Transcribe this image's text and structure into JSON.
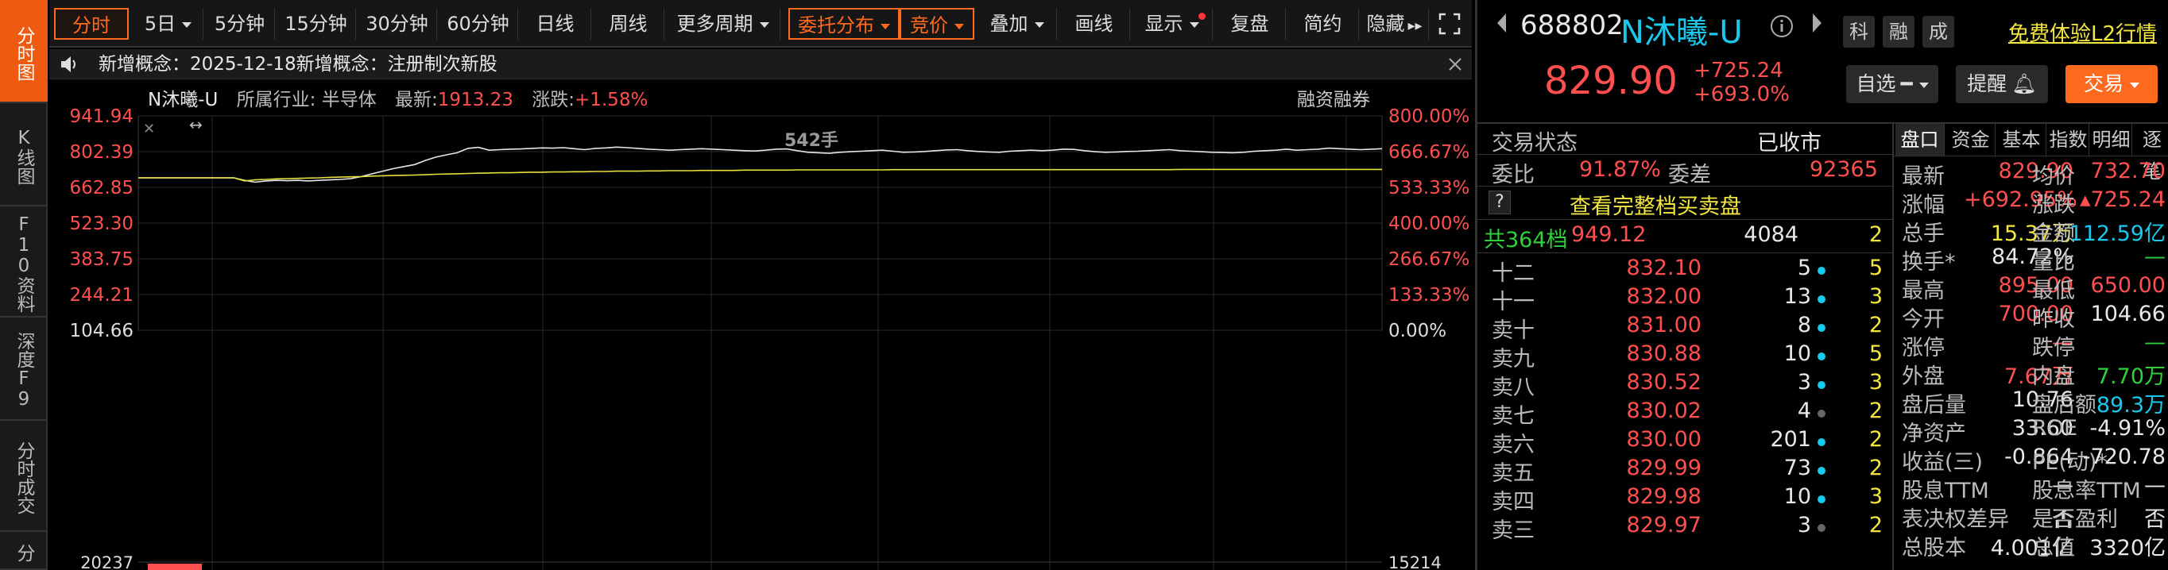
{
  "left_tabs": [
    {
      "label": "分时图"
    },
    {
      "label": "K线图"
    },
    {
      "label": "F10资料"
    },
    {
      "label": "深度F9"
    },
    {
      "label": "分时成交"
    },
    {
      "label": "分"
    }
  ],
  "toolbar": {
    "fenshi": "分时",
    "5ri": "5日",
    "5min": "5分钟",
    "15min": "15分钟",
    "30min": "30分钟",
    "60min": "60分钟",
    "rixian": "日线",
    "zhouxian": "周线",
    "more": "更多周期",
    "weituo": "委托分布",
    "jingjia": "竞价",
    "diejia": "叠加",
    "huaxian": "画线",
    "xianshi": "显示",
    "fupan": "复盘",
    "jianyue": "简约",
    "yincang": "隐藏"
  },
  "notice": {
    "text": "新增概念：2025-12-18新增概念：注册制次新股"
  },
  "chart_header": {
    "stock": "N沐曦-U",
    "industry_label": "所属行业:",
    "industry": "半导体",
    "latest_label": "最新:",
    "latest": "1913.23",
    "change_label": "涨跌:",
    "change": "+1.58%",
    "margin": "融资融券"
  },
  "chart_data": {
    "type": "line",
    "y_left_ticks": [
      "941.94",
      "802.39",
      "662.85",
      "523.30",
      "383.75",
      "244.21",
      "104.66"
    ],
    "y_right_ticks": [
      "800.00%",
      "666.67%",
      "533.33%",
      "400.00%",
      "266.67%",
      "133.33%",
      "0.00%"
    ],
    "ylim": [
      104.66,
      941.94
    ],
    "base_price": 104.66,
    "volume_left_label": "20237",
    "volume_right_label": "15214",
    "annotation": "542手",
    "series": [
      {
        "color": "#e8e8e8",
        "values": [
          700,
          700,
          700,
          700,
          700,
          700,
          700,
          700,
          700,
          700,
          690,
          683,
          688,
          690,
          689,
          690,
          688,
          690,
          692,
          694,
          697,
          705,
          716,
          726,
          736,
          744,
          752,
          768,
          781,
          790,
          798,
          815,
          819,
          808,
          810,
          812,
          813,
          815,
          817,
          816,
          818,
          814,
          810,
          815,
          817,
          820,
          818,
          815,
          812,
          810,
          808,
          810,
          812,
          814,
          812,
          810,
          808,
          806,
          805,
          808,
          812,
          813,
          806,
          800,
          798,
          796,
          800,
          802,
          804,
          806,
          808,
          804,
          800,
          801,
          803,
          806,
          809,
          810,
          806,
          803,
          801,
          800,
          804,
          806,
          808,
          806,
          808,
          812,
          811,
          806,
          802,
          800,
          801,
          803,
          804,
          806,
          808,
          810,
          806,
          804,
          802,
          800,
          799,
          798,
          800,
          804,
          806,
          808,
          812,
          808,
          810,
          812,
          816,
          814,
          812,
          810,
          812,
          814
        ]
      },
      {
        "color": "#e6e040",
        "values": [
          700,
          700,
          700,
          700,
          700,
          700,
          700,
          700,
          700,
          700,
          688,
          692,
          694,
          696,
          697,
          698,
          699,
          700,
          702,
          703,
          704,
          705,
          707,
          708,
          709,
          710,
          711,
          712,
          714,
          715,
          716,
          717,
          718,
          719,
          720,
          720,
          721,
          722,
          722,
          723,
          723,
          724,
          724,
          725,
          725,
          726,
          726,
          726,
          727,
          727,
          728,
          728,
          728,
          729,
          729,
          729,
          729,
          730,
          730,
          730,
          730,
          730,
          731,
          731,
          731,
          731,
          731,
          731,
          731,
          731,
          731,
          732,
          732,
          732,
          732,
          732,
          732,
          732,
          732,
          732,
          732,
          732,
          732,
          732,
          732,
          732,
          732,
          732,
          732,
          732,
          732,
          732,
          732,
          732,
          732,
          732,
          732,
          732,
          733,
          733,
          733,
          733,
          733,
          733,
          733,
          733,
          733,
          733,
          733,
          733,
          733,
          733,
          733,
          733,
          733,
          733,
          733,
          733
        ]
      }
    ]
  },
  "quote": {
    "code": "688802",
    "name": "N沐曦-U",
    "tags": [
      "科",
      "融",
      "成"
    ],
    "l2_link": "免费体验L2行情",
    "price": "829.90",
    "change": "+725.24",
    "change_pct": "+693.0%",
    "btn_zixuan": "自选",
    "btn_tixing": "提醒",
    "btn_jiaoyi": "交易"
  },
  "status": {
    "label": "交易状态",
    "value": "已收市"
  },
  "weibi": {
    "label1": "委比",
    "value1": "91.87%",
    "label2": "委差",
    "value2": "92365"
  },
  "full_book": {
    "q": "?",
    "text": "查看完整档买卖盘"
  },
  "total_levels": {
    "label": "共364档",
    "price": "949.12",
    "vol": "4084",
    "cnt": "2"
  },
  "levels": [
    {
      "label": "十二",
      "price": "832.10",
      "vol": "5",
      "cnt": "5",
      "dot": "#19c8ea"
    },
    {
      "label": "十一",
      "price": "832.00",
      "vol": "13",
      "cnt": "3",
      "dot": "#19c8ea"
    },
    {
      "label": "卖十",
      "price": "831.00",
      "vol": "8",
      "cnt": "2",
      "dot": "#19c8ea"
    },
    {
      "label": "卖九",
      "price": "830.88",
      "vol": "10",
      "cnt": "5",
      "dot": "#19c8ea"
    },
    {
      "label": "卖八",
      "price": "830.52",
      "vol": "3",
      "cnt": "3",
      "dot": "#19c8ea"
    },
    {
      "label": "卖七",
      "price": "830.02",
      "vol": "4",
      "cnt": "2",
      "dot": "#666666"
    },
    {
      "label": "卖六",
      "price": "830.00",
      "vol": "201",
      "cnt": "2",
      "dot": "#19c8ea"
    },
    {
      "label": "卖五",
      "price": "829.99",
      "vol": "73",
      "cnt": "2",
      "dot": "#19c8ea"
    },
    {
      "label": "卖四",
      "price": "829.98",
      "vol": "10",
      "cnt": "3",
      "dot": "#19c8ea"
    },
    {
      "label": "卖三",
      "price": "829.97",
      "vol": "3",
      "cnt": "2",
      "dot": "#666666"
    }
  ],
  "panel_tabs": [
    "盘口",
    "资金",
    "基本",
    "指数",
    "明细",
    "逐笔"
  ],
  "stats": [
    {
      "l1": "最新",
      "v1": "829.90",
      "c1": "#ff4f4f",
      "l2": "均价",
      "v2": "732.70",
      "c2": "#ff4f4f"
    },
    {
      "l1": "涨幅",
      "v1": "+692.95%",
      "c1": "#ff4f4f",
      "l2": "涨跌",
      "v2": "▴725.24",
      "c2": "#ff4f4f"
    },
    {
      "l1": "总手",
      "v1": "15.37万",
      "c1": "#f2e640",
      "l2": "金额",
      "v2": "112.59亿",
      "c2": "#19c8ea"
    },
    {
      "l1": "换手*",
      "v1": "84.72%",
      "c1": "#e8e8e8",
      "l2": "量比",
      "v2": "—",
      "c2": "#2ed13c"
    },
    {
      "l1": "最高",
      "v1": "895.00",
      "c1": "#ff4f4f",
      "l2": "最低",
      "v2": "650.00",
      "c2": "#ff4f4f"
    },
    {
      "l1": "今开",
      "v1": "700.00",
      "c1": "#ff4f4f",
      "l2": "昨收",
      "v2": "104.66",
      "c2": "#e8e8e8"
    },
    {
      "l1": "涨停",
      "v1": "—",
      "c1": "#ff4f4f",
      "l2": "跌停",
      "v2": "—",
      "c2": "#2ed13c"
    },
    {
      "l1": "外盘",
      "v1": "7.67万",
      "c1": "#ff4f4f",
      "l2": "内盘",
      "v2": "7.70万",
      "c2": "#2ed13c"
    },
    {
      "l1": "盘后量",
      "v1": "10.76",
      "c1": "#e8e8e8",
      "l2": "盘后额",
      "v2": "89.3万",
      "c2": "#19c8ea"
    },
    {
      "l1": "净资产",
      "v1": "33.60",
      "c1": "#e8e8e8",
      "l2": "ROE",
      "v2": "-4.91%",
      "c2": "#e8e8e8"
    },
    {
      "l1": "收益(三)",
      "v1": "-0.864",
      "c1": "#e8e8e8",
      "l2": "PE(动)*",
      "v2": "-720.78",
      "c2": "#e8e8e8"
    },
    {
      "l1": "股息TTM",
      "v1": "—",
      "c1": "#e8e8e8",
      "l2": "股息率TTM",
      "v2": "—",
      "c2": "#e8e8e8"
    },
    {
      "l1": "表决权差异",
      "v1": "否",
      "c1": "#e8e8e8",
      "l2": "是否盈利",
      "v2": "否",
      "c2": "#e8e8e8"
    },
    {
      "l1": "总股本",
      "v1": "4.001亿",
      "c1": "#e8e8e8",
      "l2": "总值",
      "v2": "3320亿",
      "c2": "#e8e8e8"
    }
  ]
}
